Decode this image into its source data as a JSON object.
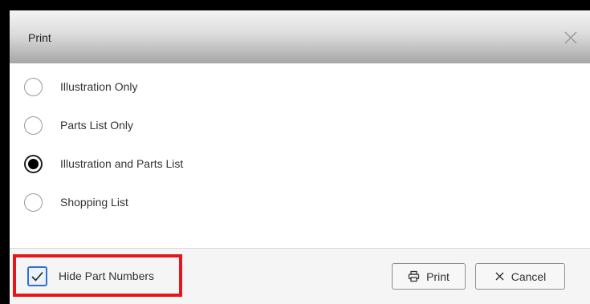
{
  "dialog": {
    "title": "Print",
    "close_icon": "close-icon"
  },
  "options": [
    {
      "label": "Illustration Only",
      "checked": false
    },
    {
      "label": "Parts List Only",
      "checked": false
    },
    {
      "label": "Illustration and Parts List",
      "checked": true
    },
    {
      "label": "Shopping List",
      "checked": false
    }
  ],
  "footer": {
    "hide_part_numbers": {
      "label": "Hide Part Numbers",
      "checked": true
    },
    "print_label": "Print",
    "print_icon": "printer-icon",
    "cancel_label": "Cancel",
    "cancel_icon": "close-icon",
    "highlight_color": "#e8141b",
    "checkbox_accent": "#2f6fd6"
  }
}
